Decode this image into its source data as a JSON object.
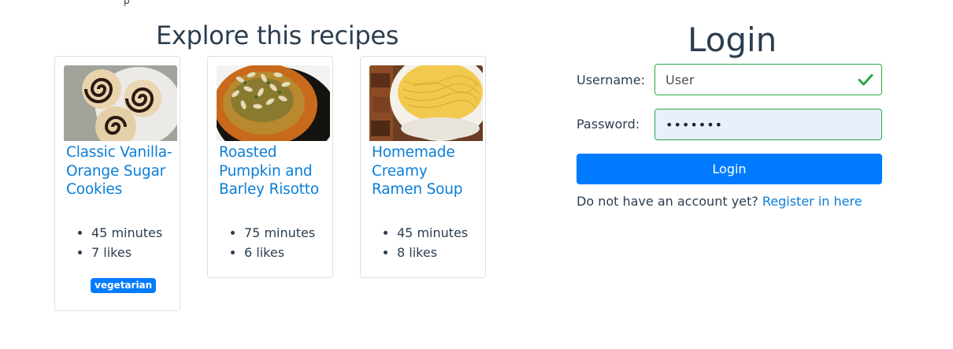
{
  "explore": {
    "title": "Explore this recipes",
    "recipes": [
      {
        "title": "Classic Vanilla-Orange Sugar Cookies",
        "time": "45 minutes",
        "likes": "7 likes",
        "badge": "vegetarian"
      },
      {
        "title": "Roasted Pumpkin and Barley Risotto",
        "time": "75 minutes",
        "likes": "6 likes"
      },
      {
        "title": "Homemade Creamy Ramen Soup",
        "time": "45 minutes",
        "likes": "8 likes"
      }
    ]
  },
  "login": {
    "title": "Login",
    "username_label": "Username:",
    "username_value": "User",
    "password_label": "Password:",
    "password_value": "1234567",
    "submit_label": "Login",
    "register_prompt": "Do not have an account yet?",
    "register_link": "Register in here"
  },
  "colors": {
    "link": "#0a7ed8",
    "primary": "#007bff",
    "valid": "#28a745",
    "text": "#2c3e50"
  }
}
